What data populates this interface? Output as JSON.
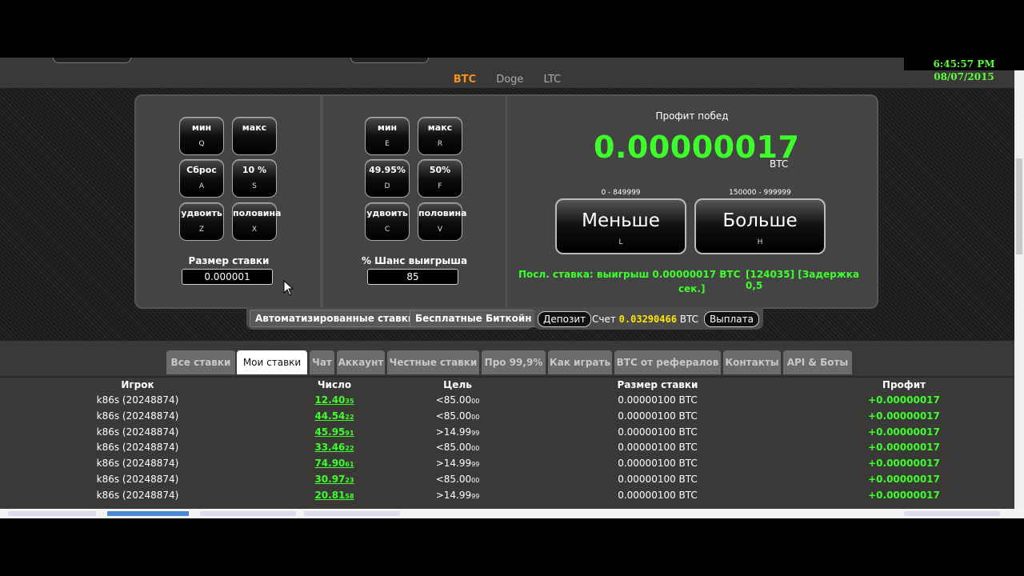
{
  "clock": "6:45:57 PM 08/07/2015",
  "currencies": [
    "BTC",
    "Doge",
    "LTC"
  ],
  "active_currency": "BTC",
  "bet_panel": {
    "buttons": [
      {
        "label": "мин",
        "key": "Q"
      },
      {
        "label": "макс",
        "key": ""
      },
      {
        "label": "Сброс",
        "key": "A"
      },
      {
        "label": "10 %",
        "key": "S"
      },
      {
        "label": "удвоить",
        "key": "Z"
      },
      {
        "label": "половина",
        "key": "X"
      }
    ],
    "label": "Размер ставки",
    "value": "0.000001"
  },
  "chance_panel": {
    "buttons": [
      {
        "label": "мин",
        "key": "E"
      },
      {
        "label": "макс",
        "key": "R"
      },
      {
        "label": "49.95%",
        "key": "D"
      },
      {
        "label": "50%",
        "key": "F"
      },
      {
        "label": "удвоить",
        "key": "C"
      },
      {
        "label": "половина",
        "key": "V"
      }
    ],
    "label": "% Шанс выигрыша",
    "value": "85"
  },
  "profit_panel": {
    "title": "Профит побед",
    "value": "0.00000017",
    "unit": "BTC",
    "low_range": "0 - 849999",
    "high_range": "150000 - 999999",
    "low_button": {
      "label": "Меньше",
      "key": "L"
    },
    "high_button": {
      "label": "Больше",
      "key": "H"
    },
    "last_bet": "Посл. ставка: выигрыш 0.00000017 BTC",
    "last_bet_id": "[124035] [Задержка 0,5",
    "last_bet_cont": "сек.]"
  },
  "actions": {
    "auto": "Автоматизированные ставки",
    "free": "Бесплатные Биткойн",
    "deposit": "Депозит",
    "account_label": "Счет",
    "balance": "0.03290466",
    "balance_unit": "BTC",
    "withdraw": "Выплата"
  },
  "tabs": [
    {
      "label": "Все ставки",
      "active": false
    },
    {
      "label": "Мои ставки",
      "active": true
    },
    {
      "label": "Чат",
      "active": false
    },
    {
      "label": "Аккаунт",
      "active": false
    },
    {
      "label": "Честные ставки",
      "active": false
    },
    {
      "label": "Про 99,9%",
      "active": false
    },
    {
      "label": "Как играть",
      "active": false
    },
    {
      "label": "BTC от рефералов",
      "active": false
    },
    {
      "label": "Контакты",
      "active": false
    },
    {
      "label": "API & Боты",
      "active": false
    }
  ],
  "table": {
    "headers": [
      "Игрок",
      "Число",
      "Цель",
      "Размер ставки",
      "Профит"
    ],
    "rows": [
      {
        "player": "k86s (20248874)",
        "num": "12.40",
        "num_small": "35",
        "target": "<85.00",
        "target_small": "00",
        "bet": "0.00000100 BTC",
        "profit": "+0.00000017"
      },
      {
        "player": "k86s (20248874)",
        "num": "44.54",
        "num_small": "22",
        "target": "<85.00",
        "target_small": "00",
        "bet": "0.00000100 BTC",
        "profit": "+0.00000017"
      },
      {
        "player": "k86s (20248874)",
        "num": "45.95",
        "num_small": "91",
        "target": ">14.99",
        "target_small": "99",
        "bet": "0.00000100 BTC",
        "profit": "+0.00000017"
      },
      {
        "player": "k86s (20248874)",
        "num": "33.46",
        "num_small": "22",
        "target": "<85.00",
        "target_small": "00",
        "bet": "0.00000100 BTC",
        "profit": "+0.00000017"
      },
      {
        "player": "k86s (20248874)",
        "num": "74.90",
        "num_small": "61",
        "target": ">14.99",
        "target_small": "99",
        "bet": "0.00000100 BTC",
        "profit": "+0.00000017"
      },
      {
        "player": "k86s (20248874)",
        "num": "30.97",
        "num_small": "23",
        "target": "<85.00",
        "target_small": "00",
        "bet": "0.00000100 BTC",
        "profit": "+0.00000017"
      },
      {
        "player": "k86s (20248874)",
        "num": "20.81",
        "num_small": "58",
        "target": ">14.99",
        "target_small": "99",
        "bet": "0.00000100 BTC",
        "profit": "+0.00000017"
      }
    ]
  },
  "colors": {
    "accent": "#f7931a",
    "win": "#3cff2a",
    "balance": "#ffe500"
  }
}
